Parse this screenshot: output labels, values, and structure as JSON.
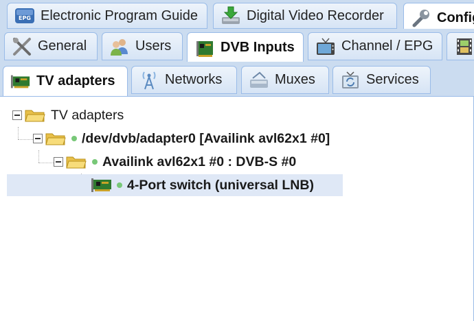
{
  "top_tabs": [
    {
      "label": "Electronic Program Guide",
      "icon": "epg-icon"
    },
    {
      "label": "Digital Video Recorder",
      "icon": "dvr-download-icon"
    },
    {
      "label": "Configu",
      "icon": "wrench-icon"
    }
  ],
  "config_tabs": [
    {
      "label": "General",
      "icon": "tools-icon"
    },
    {
      "label": "Users",
      "icon": "users-icon"
    },
    {
      "label": "DVB Inputs",
      "icon": "dvb-card-icon"
    },
    {
      "label": "Channel / EPG",
      "icon": "tv-icon"
    },
    {
      "label": "",
      "icon": "film-icon"
    }
  ],
  "dvb_tabs": [
    {
      "label": "TV adapters",
      "icon": "adapter-card-icon"
    },
    {
      "label": "Networks",
      "icon": "antenna-icon"
    },
    {
      "label": "Muxes",
      "icon": "mux-icon"
    },
    {
      "label": "Services",
      "icon": "services-icon"
    }
  ],
  "tree": {
    "root": "TV adapters",
    "adapter": "/dev/dvb/adapter0 [Availink avl62x1 #0]",
    "frontend": "Availink avl62x1 #0 : DVB-S #0",
    "switch": "4-Port switch (universal LNB)"
  },
  "colors": {
    "tab_strip": "#cbdcf0",
    "tab_border": "#99bbe8",
    "selection": "#dfe8f6",
    "status_dot": "#78c878"
  }
}
